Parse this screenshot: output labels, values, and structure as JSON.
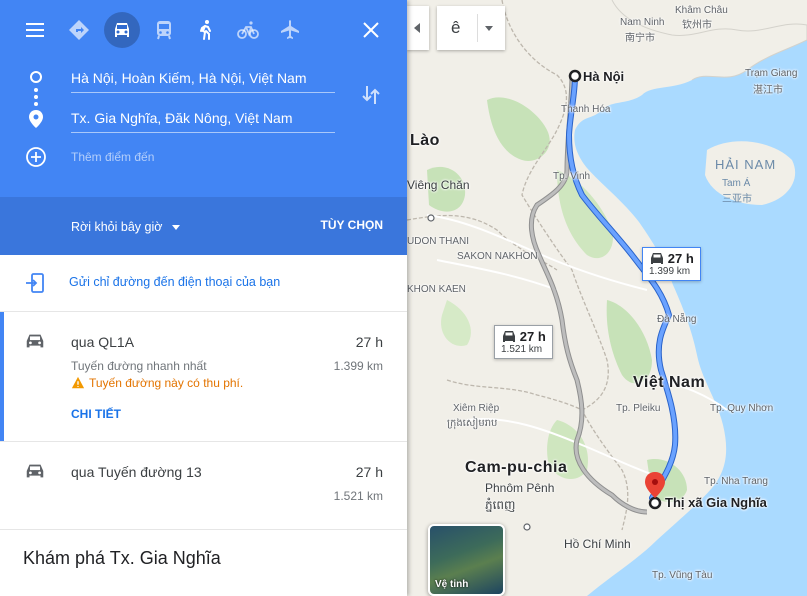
{
  "modes": {
    "menu": "menu-icon",
    "best": "directions-icon",
    "car": "car-icon",
    "transit": "transit-icon",
    "walk": "walk-icon",
    "bike": "bike-icon",
    "flight": "flight-icon",
    "close": "close-icon",
    "active": "car"
  },
  "waypoints": {
    "from": "Hà Nội, Hoàn Kiếm, Hà Nội, Việt Nam",
    "to": "Tx. Gia Nghĩa, Đăk Nông, Việt Nam",
    "add_destination": "Thêm điểm đến"
  },
  "options": {
    "depart": "Rời khỏi bây giờ",
    "options_button": "TÙY CHỌN"
  },
  "send_to_phone": "Gửi chỉ đường đến điện thoại của bạn",
  "routes": [
    {
      "title": "qua QL1A",
      "time": "27 h",
      "subtitle": "Tuyến đường nhanh nhất",
      "distance": "1.399 km",
      "warning": "Tuyến đường này có thu phí.",
      "details": "CHI TIẾT"
    },
    {
      "title": "qua Tuyến đường 13",
      "time": "27 h",
      "distance": "1.521 km"
    }
  ],
  "explore": "Khám phá Tx. Gia Nghĩa",
  "map": {
    "lang_value": "ê",
    "satellite": "Vệ tinh",
    "box_main": {
      "time": "27 h",
      "distance": "1.399 km"
    },
    "box_alt": {
      "time": "27 h",
      "distance": "1.521 km"
    },
    "labels": {
      "hanoi": "Hà Nội",
      "thanh_hoa": "Thanh Hóa",
      "vinh": "Tp. Vinh",
      "lao": "Lào",
      "vieng_chan": "Viêng Chăn",
      "udon": "UDON THANI",
      "sakon": "SAKON NAKHON",
      "khon": "KHON KAEN",
      "da_nang": "Đà Nẵng",
      "viet_nam": "Việt Nam",
      "pleiku": "Tp. Pleiku",
      "quy_nhon": "Tp. Quy Nhơn",
      "xiem_riep": "Xiêm Riệp",
      "xiem_riep_km": "ក្រុងសៀមរាប",
      "cam_pu_chia": "Cam-pu-chia",
      "phnom_penh": "Phnôm Pênh",
      "phnom_penh_km": "ភ្នំពេញ",
      "nha_trang": "Tp. Nha Trang",
      "gia_nghia": "Thị xã Gia Nghĩa",
      "ho_chi_minh": "Hồ Chí Minh",
      "vung_tau": "Tp. Vũng Tàu",
      "hai_nam": "HẢI NAM",
      "tam_a": "Tam Á",
      "tam_a_cn": "三亚市",
      "truong_giang": "Trạm Giang",
      "truong_giang_cn": "湛江市",
      "khu_chau": "Khâm Châu",
      "khu_chau_cn": "钦州市",
      "nam_ninh": "Nam Ninh",
      "nam_ninh_cn": "南宁市"
    }
  },
  "colors": {
    "header": "#4285f4",
    "link": "#1a73e8",
    "warning": "#e37400",
    "route_main": "#4285f4",
    "route_alt": "#9e9e9e"
  }
}
